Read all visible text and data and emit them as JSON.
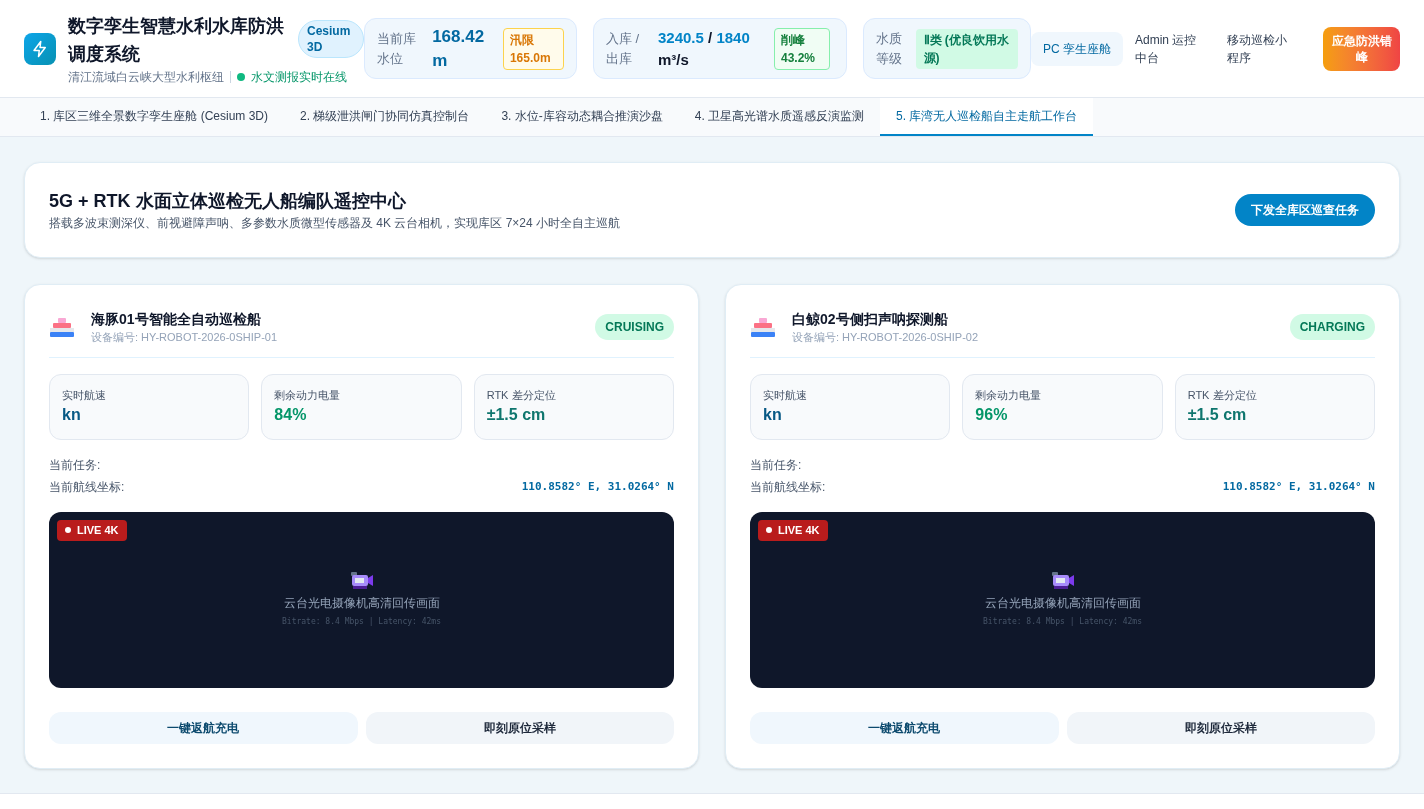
{
  "header": {
    "title": "数字孪生智慧水利水库防洪调度系统",
    "badge": "Cesium 3D",
    "subtitle": "清江流域白云峡大型水利枢纽",
    "status": "水文测报实时在线",
    "stats": [
      {
        "kind": "level",
        "label": "当前库水位",
        "value": "168.42 m",
        "tag": "汛限 165.0m"
      },
      {
        "kind": "flow",
        "label": "入库 / 出库",
        "inflow": "3240.5",
        "separator": "/",
        "outflow": "1840",
        "unit": "m³/s",
        "tag": "削峰 43.2%"
      },
      {
        "kind": "quality",
        "label": "水质等级",
        "tag": "Ⅱ类 (优良饮用水源)"
      }
    ],
    "nav": [
      {
        "label": "PC 孪生座舱",
        "selected": true
      },
      {
        "label": "Admin 运控中台",
        "selected": false
      },
      {
        "label": "移动巡检小程序",
        "selected": false
      }
    ],
    "emergency_button": "应急防洪错峰"
  },
  "tabs": [
    {
      "label": "1. 库区三维全景数字孪生座舱 (Cesium 3D)",
      "selected": false
    },
    {
      "label": "2. 梯级泄洪闸门协同仿真控制台",
      "selected": false
    },
    {
      "label": "3. 水位-库容动态耦合推演沙盘",
      "selected": false
    },
    {
      "label": "4. 卫星高光谱水质遥感反演监测",
      "selected": false
    },
    {
      "label": "5. 库湾无人巡检船自主走航工作台",
      "selected": true
    }
  ],
  "hero": {
    "title": "5G + RTK 水面立体巡检无人船编队遥控中心",
    "description": "搭载多波束测深仪、前视避障声呐、多参数水质微型传感器及 4K 云台相机，实现库区 7×24 小时全自主巡航",
    "button": "下发全库区巡查任务"
  },
  "ships": [
    {
      "name": "海豚01号智能全自动巡检船",
      "device_id": "设备编号: HY-ROBOT-2026-0SHIP-01",
      "status": "CRUISING",
      "stats": [
        {
          "kind": "speed",
          "label": "实时航速",
          "value": "kn"
        },
        {
          "kind": "battery",
          "label": "剩余动力电量",
          "value": "84%"
        },
        {
          "kind": "position",
          "label": "RTK 差分定位",
          "value": "±1.5 cm"
        }
      ],
      "task_label": "当前任务:",
      "coord_label": "当前航线坐标:",
      "coord": "110.8582° E, 31.0264° N",
      "video": {
        "badge": "LIVE 4K",
        "caption": "云台光电摄像机高清回传画面",
        "meta": "Bitrate: 8.4 Mbps | Latency: 42ms"
      },
      "buttons": [
        {
          "kind": "primary",
          "label": "一键返航充电"
        },
        {
          "kind": "secondary",
          "label": "即刻原位采样"
        }
      ]
    },
    {
      "name": "白鲸02号侧扫声呐探测船",
      "device_id": "设备编号: HY-ROBOT-2026-0SHIP-02",
      "status": "CHARGING",
      "stats": [
        {
          "kind": "speed",
          "label": "实时航速",
          "value": "kn"
        },
        {
          "kind": "battery",
          "label": "剩余动力电量",
          "value": "96%"
        },
        {
          "kind": "position",
          "label": "RTK 差分定位",
          "value": "±1.5 cm"
        }
      ],
      "task_label": "当前任务:",
      "coord_label": "当前航线坐标:",
      "coord": "110.8582° E, 31.0264° N",
      "video": {
        "badge": "LIVE 4K",
        "caption": "云台光电摄像机高清回传画面",
        "meta": "Bitrate: 8.4 Mbps | Latency: 42ms"
      },
      "buttons": [
        {
          "kind": "primary",
          "label": "一键返航充电"
        },
        {
          "kind": "secondary",
          "label": "即刻原位采样"
        }
      ]
    }
  ]
}
